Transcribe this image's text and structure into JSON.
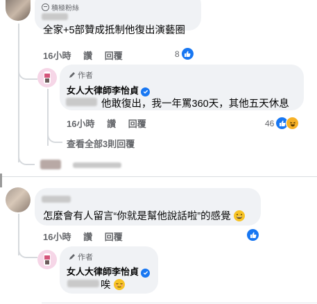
{
  "comment1": {
    "badge": "積極粉絲",
    "text": "全家+5部贊成抵制他復出演藝圈",
    "time": "16小時",
    "like_label": "讚",
    "reply_label": "回覆",
    "reaction_count": "8"
  },
  "reply1": {
    "author_tag": "作者",
    "name": "女人大律師李怡貞",
    "text": "他敢復出，我一年罵360天，其他五天休息",
    "time": "16小時",
    "like_label": "讚",
    "reply_label": "回覆",
    "reaction_count": "46"
  },
  "view_more": "查看全部3則回覆",
  "comment2": {
    "text": "怎麼會有人留言“你就是幫他說話啦”的感覺",
    "time": "16小時",
    "like_label": "讚",
    "reply_label": "回覆"
  },
  "reply2": {
    "author_tag": "作者",
    "name": "女人大律師李怡貞",
    "text": "唉"
  },
  "colors": {
    "accent": "#1877f2",
    "bubble": "#f0f2f5",
    "muted": "#65676b"
  }
}
